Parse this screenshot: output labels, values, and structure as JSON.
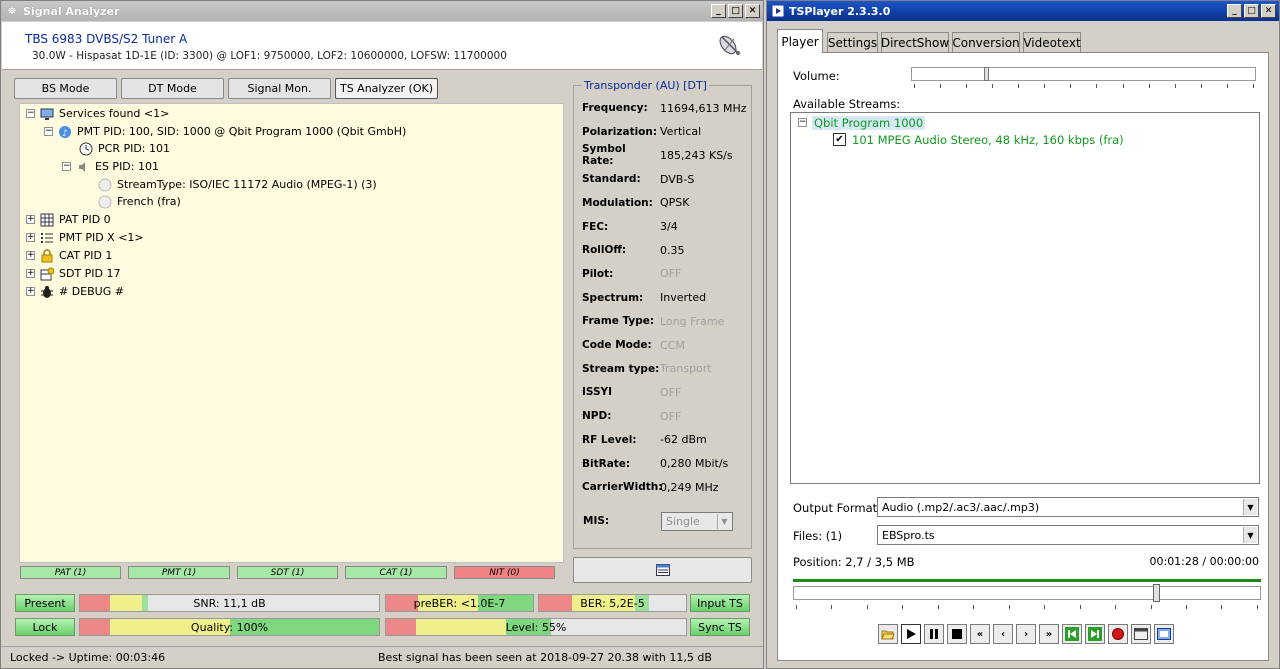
{
  "signal_analyzer": {
    "title": "Signal Analyzer",
    "device_name": "TBS 6983 DVBS/S2 Tuner A",
    "device_info": "30.0W - Hispasat 1D-1E (ID: 3300) @ LOF1: 9750000, LOF2: 10600000, LOFSW: 11700000",
    "mode_buttons": [
      "BS Mode",
      "DT Mode",
      "Signal Mon.",
      "TS Analyzer (OK)"
    ],
    "tree": {
      "services": "Services found <1>",
      "pmt_service": "PMT PID: 100, SID: 1000 @ Qbit Program 1000 (Qbit GmbH)",
      "pcr": "PCR PID: 101",
      "es": "ES PID: 101",
      "stream_type": "StreamType: ISO/IEC 11172 Audio (MPEG-1) (3)",
      "language": "French (fra)",
      "pat": "PAT PID 0",
      "pmt": "PMT PID X <1>",
      "cat": "CAT PID 1",
      "sdt": "SDT PID 17",
      "debug": "# DEBUG #"
    },
    "transponder": {
      "header": "Transponder (AU) [DT]",
      "rows": [
        {
          "label": "Frequency:",
          "value": "11694,613 MHz",
          "dim": false
        },
        {
          "label": "Polarization:",
          "value": "Vertical",
          "dim": false
        },
        {
          "label": "Symbol Rate:",
          "value": "185,243 KS/s",
          "dim": false
        },
        {
          "label": "Standard:",
          "value": "DVB-S",
          "dim": false
        },
        {
          "label": "Modulation:",
          "value": "QPSK",
          "dim": false
        },
        {
          "label": "FEC:",
          "value": "3/4",
          "dim": false
        },
        {
          "label": "RollOff:",
          "value": "0.35",
          "dim": false
        },
        {
          "label": "Pilot:",
          "value": "OFF",
          "dim": true
        },
        {
          "label": "Spectrum:",
          "value": "Inverted",
          "dim": false
        },
        {
          "label": "Frame Type:",
          "value": "Long Frame",
          "dim": true
        },
        {
          "label": "Code Mode:",
          "value": "CCM",
          "dim": true
        },
        {
          "label": "Stream type:",
          "value": "Transport",
          "dim": true
        },
        {
          "label": "ISSYI",
          "value": "OFF",
          "dim": true
        },
        {
          "label": "NPD:",
          "value": "OFF",
          "dim": true
        },
        {
          "label": "RF Level:",
          "value": "-62 dBm",
          "dim": false
        },
        {
          "label": "BitRate:",
          "value": "0,280 Mbit/s",
          "dim": false
        },
        {
          "label": "CarrierWidth:",
          "value": "0,249 MHz",
          "dim": false
        }
      ],
      "mis_label": "MIS:",
      "mis_value": "Single"
    },
    "ts_status": [
      "PAT (1)",
      "PMT (1)",
      "SDT (1)",
      "CAT (1)",
      "NIT (0)"
    ],
    "present": "Present",
    "lock": "Lock",
    "snr": "SNR: 11,1 dB",
    "quality": "Quality: 100%",
    "quality_percent": 100,
    "preber": "preBER: <1.0E-7",
    "ber": "BER: 5,2E-5",
    "level": "Level: 55%",
    "level_percent": 55,
    "input_ts": "Input TS",
    "sync_ts": "Sync TS",
    "status_left": "Locked -> Uptime: 00:03:46",
    "status_right": "Best signal has been seen at 2018-09-27 20.38 with 11,5 dB"
  },
  "tsplayer": {
    "title": "TSPlayer 2.3.3.0",
    "tabs": [
      "Player",
      "Settings",
      "DirectShow",
      "Conversion",
      "Videotext"
    ],
    "volume_label": "Volume:",
    "streams_label": "Available Streams:",
    "program": "Qbit Program 1000",
    "stream": "101  MPEG Audio Stereo, 48 kHz, 160 kbps (fra)",
    "output_format_label": "Output Format:",
    "output_format_value": "Audio  (.mp2/.ac3/.aac/.mp3)",
    "files_label": "Files: (1)",
    "files_value": "EBSpro.ts",
    "position": "Position: 2,7 / 3,5 MB",
    "time": "00:01:28 / 00:00:00",
    "position_fraction": 0.77
  },
  "colors": {
    "program_green": "#0f9a1c",
    "ok_green": "#a6e8a6",
    "error_red": "#f08484"
  }
}
